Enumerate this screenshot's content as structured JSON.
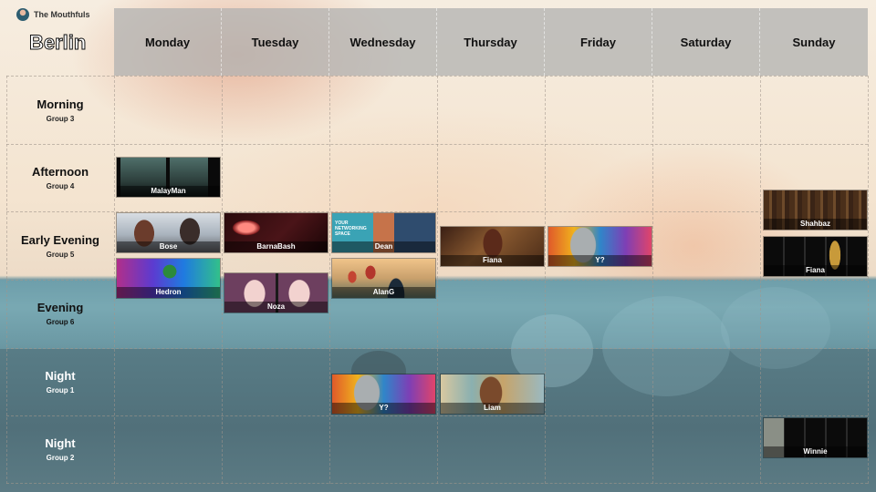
{
  "brand": {
    "name": "The Mouthfuls"
  },
  "city": "Berlin",
  "days": [
    "Monday",
    "Tuesday",
    "Wednesday",
    "Thursday",
    "Friday",
    "Saturday",
    "Sunday"
  ],
  "rows": [
    {
      "name": "Morning",
      "group": "Group 3"
    },
    {
      "name": "Afternoon",
      "group": "Group 4"
    },
    {
      "name": "Early Evening",
      "group": "Group 5"
    },
    {
      "name": "Evening",
      "group": "Group 6"
    },
    {
      "name": "Night",
      "group": "Group 1"
    },
    {
      "name": "Night",
      "group": "Group 2"
    }
  ],
  "events": [
    {
      "label": "MalayMan",
      "day": "Monday",
      "row": "Afternoon",
      "art": "dark-portraits"
    },
    {
      "label": "Bose",
      "day": "Monday",
      "row": "Early Evening",
      "art": "couple-city"
    },
    {
      "label": "Hedron",
      "day": "Monday",
      "row": "Early Evening",
      "art": "stage-rainbow"
    },
    {
      "label": "BarnaBash",
      "day": "Tuesday",
      "row": "Early Evening",
      "art": "neon-mic"
    },
    {
      "label": "Noza",
      "day": "Tuesday",
      "row": "Early Evening",
      "art": "anime-duo"
    },
    {
      "label": "Dean",
      "day": "Wednesday",
      "row": "Early Evening",
      "art": "networking",
      "art_text": "YOUR NETWORKING SPACE"
    },
    {
      "label": "AlanG",
      "day": "Wednesday",
      "row": "Early Evening",
      "art": "balloons"
    },
    {
      "label": "Fiana",
      "day": "Thursday",
      "row": "Early Evening",
      "art": "bar-crowd"
    },
    {
      "label": "Y?",
      "day": "Friday",
      "row": "Early Evening",
      "art": "colorful-statue"
    },
    {
      "label": "Shahbaz",
      "day": "Sunday",
      "row": "Afternoon",
      "art": "library"
    },
    {
      "label": "Fiana",
      "day": "Sunday",
      "row": "Early Evening",
      "art": "trophy-dark"
    },
    {
      "label": "Y?",
      "day": "Wednesday",
      "row": "Night",
      "art": "colorful-statue"
    },
    {
      "label": "Liam",
      "day": "Thursday",
      "row": "Night",
      "art": "money-man"
    },
    {
      "label": "Winnie",
      "day": "Sunday",
      "row": "Night",
      "art": "dark-panels"
    }
  ]
}
